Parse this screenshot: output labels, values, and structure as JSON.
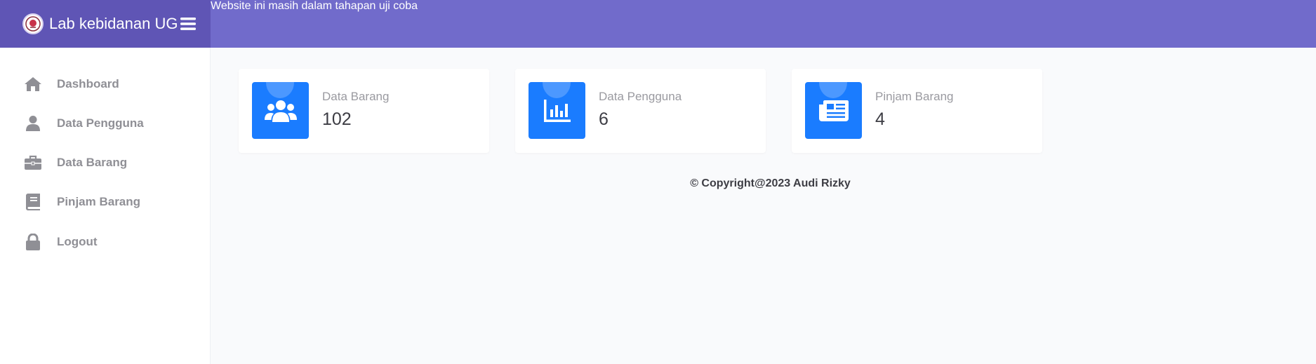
{
  "header": {
    "brand_title": "Lab kebidanan UG",
    "notice": "Website ini masih dalam tahapan uji coba",
    "colors": {
      "brand_bg": "#5f55b5",
      "topbar_bg": "#716bcb"
    }
  },
  "sidebar": {
    "items": [
      {
        "label": "Dashboard",
        "icon": "home-icon"
      },
      {
        "label": "Data Pengguna",
        "icon": "user-icon"
      },
      {
        "label": "Data Barang",
        "icon": "briefcase-icon"
      },
      {
        "label": "Pinjam Barang",
        "icon": "book-icon"
      },
      {
        "label": "Logout",
        "icon": "lock-icon"
      }
    ]
  },
  "cards": [
    {
      "label": "Data Barang",
      "value": "102",
      "icon": "users-icon"
    },
    {
      "label": "Data Pengguna",
      "value": "6",
      "icon": "bar-chart-icon"
    },
    {
      "label": "Pinjam Barang",
      "value": "4",
      "icon": "newspaper-icon"
    }
  ],
  "footer": {
    "copyright": "© Copyright@2023 Audi Rizky"
  },
  "accent_color": "#1a7cff"
}
